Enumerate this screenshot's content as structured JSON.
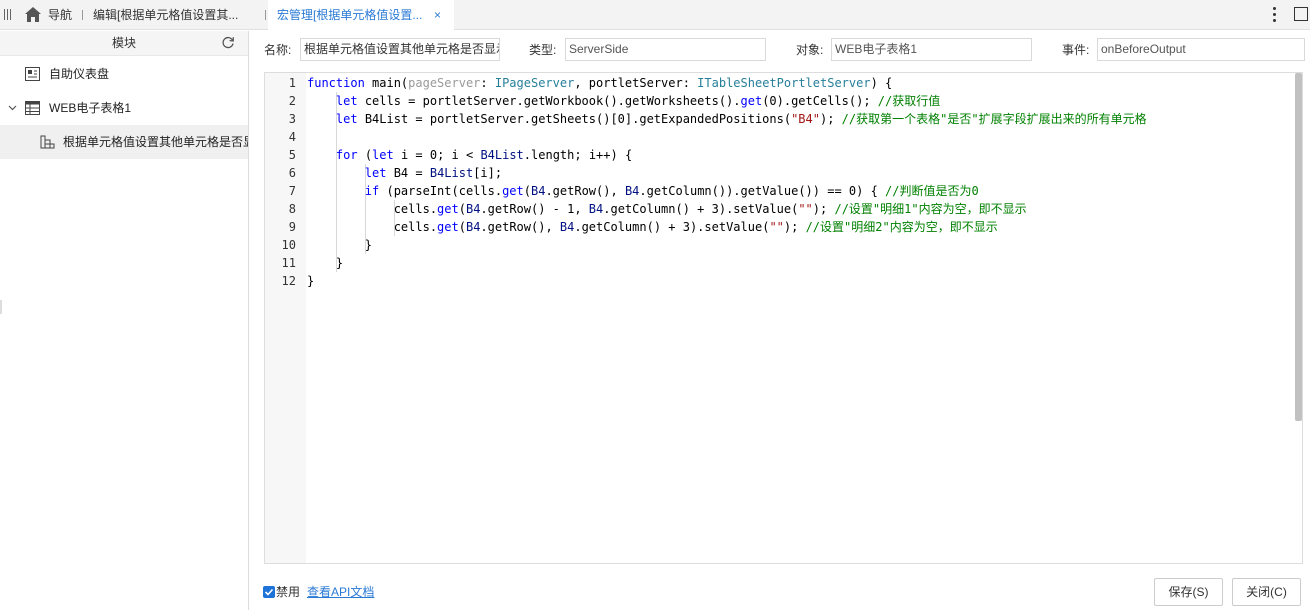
{
  "tabs": [
    {
      "label": "导航"
    },
    {
      "label": "编辑[根据单元格值设置其..."
    },
    {
      "label": "宏管理[根据单元格值设置..."
    }
  ],
  "tab_close": "×",
  "sidebar": {
    "header": "模块",
    "items": [
      {
        "label": "自助仪表盘",
        "icon": "dashboard-icon"
      },
      {
        "label": "WEB电子表格1",
        "icon": "spreadsheet-icon",
        "expanded": true
      },
      {
        "label": "根据单元格值设置其他单元格是否显",
        "icon": "macro-icon",
        "selected": true
      }
    ]
  },
  "form": {
    "name_label": "名称:",
    "name_value": "根据单元格值设置其他单元格是否显示",
    "type_label": "类型:",
    "type_value": "ServerSide",
    "object_label": "对象:",
    "object_value": "WEB电子表格1",
    "event_label": "事件:",
    "event_value": "onBeforeOutput"
  },
  "editor": {
    "line_numbers": [
      "1",
      "2",
      "3",
      "4",
      "5",
      "6",
      "7",
      "8",
      "9",
      "10",
      "11",
      "12"
    ]
  },
  "footer": {
    "disable_label": "禁用",
    "disable_checked": true,
    "api_link": "查看API文档",
    "save_label": "保存(S)",
    "close_label": "关闭(C)"
  },
  "colors": {
    "accent": "#2a7ad5",
    "keyword": "#0000ff",
    "type": "#267f99",
    "comment": "#008000",
    "string": "#a31515"
  }
}
